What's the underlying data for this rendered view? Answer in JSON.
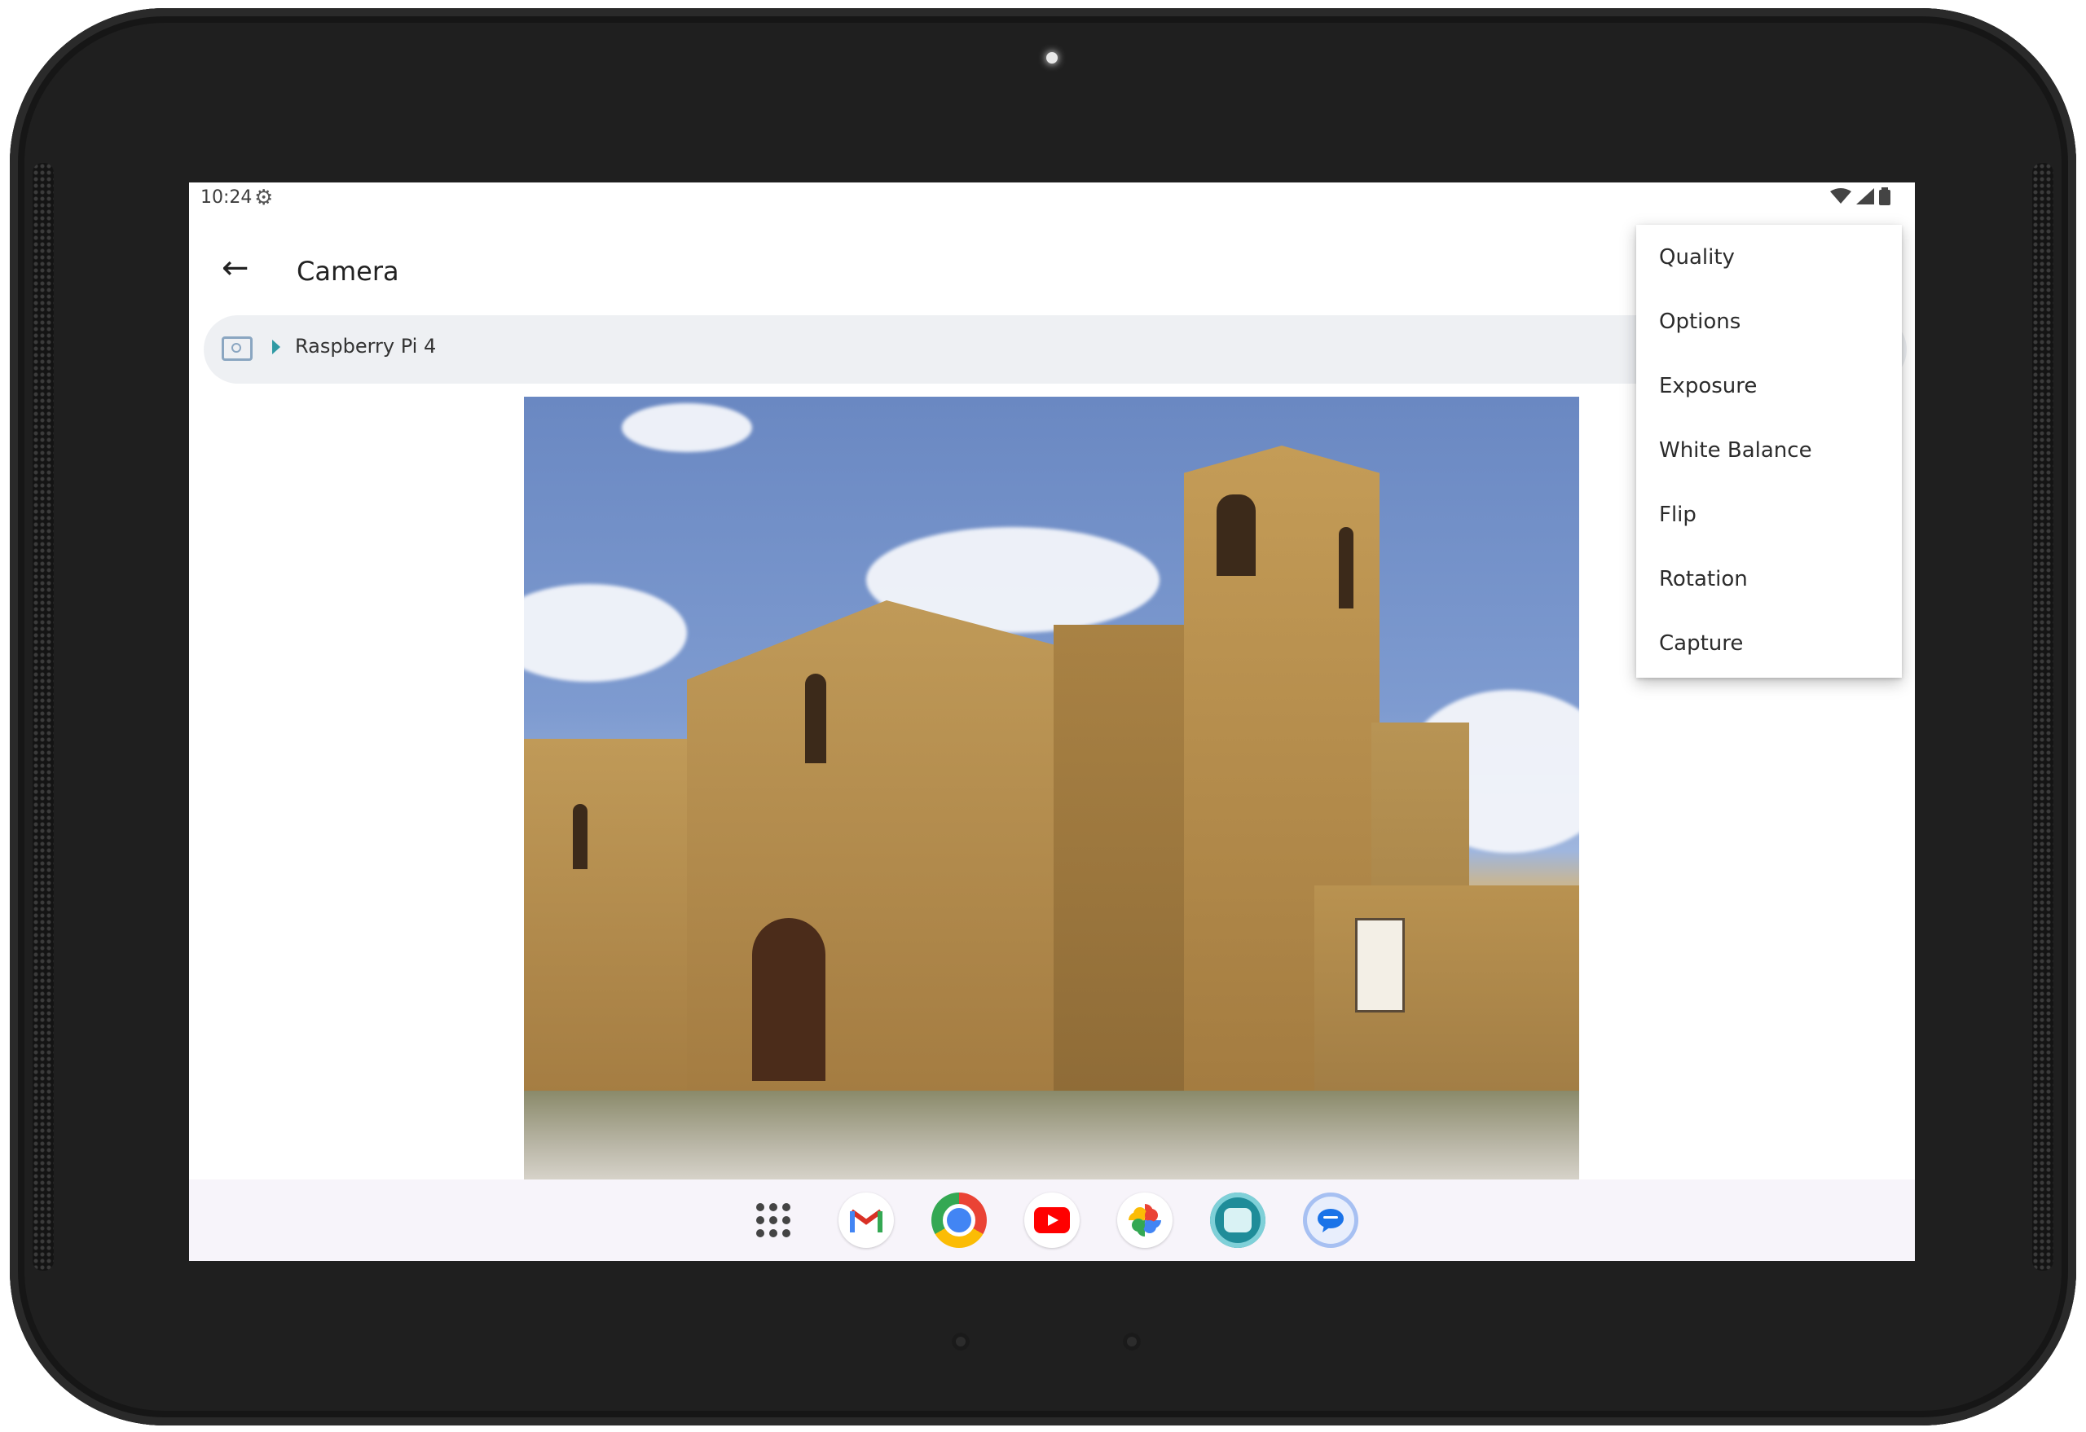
{
  "status_bar": {
    "time": "10:24",
    "settings_icon": "gear-icon",
    "wifi_icon": "wifi-icon",
    "signal_icon": "signal-icon",
    "battery_icon": "battery-icon"
  },
  "app_bar": {
    "back_icon": "arrow-left-icon",
    "title": "Camera"
  },
  "breadcrumb": {
    "device_icon": "camera-device-icon",
    "label": "Raspberry Pi 4"
  },
  "menu": {
    "items": [
      {
        "label": "Quality"
      },
      {
        "label": "Options"
      },
      {
        "label": "Exposure"
      },
      {
        "label": "White Balance"
      },
      {
        "label": "Flip"
      },
      {
        "label": "Rotation"
      },
      {
        "label": "Capture"
      }
    ]
  },
  "taskbar": {
    "icons": [
      "apps-grid-icon",
      "gmail-icon",
      "chrome-icon",
      "youtube-icon",
      "photos-icon",
      "raspberry-app-icon",
      "messages-icon"
    ]
  }
}
